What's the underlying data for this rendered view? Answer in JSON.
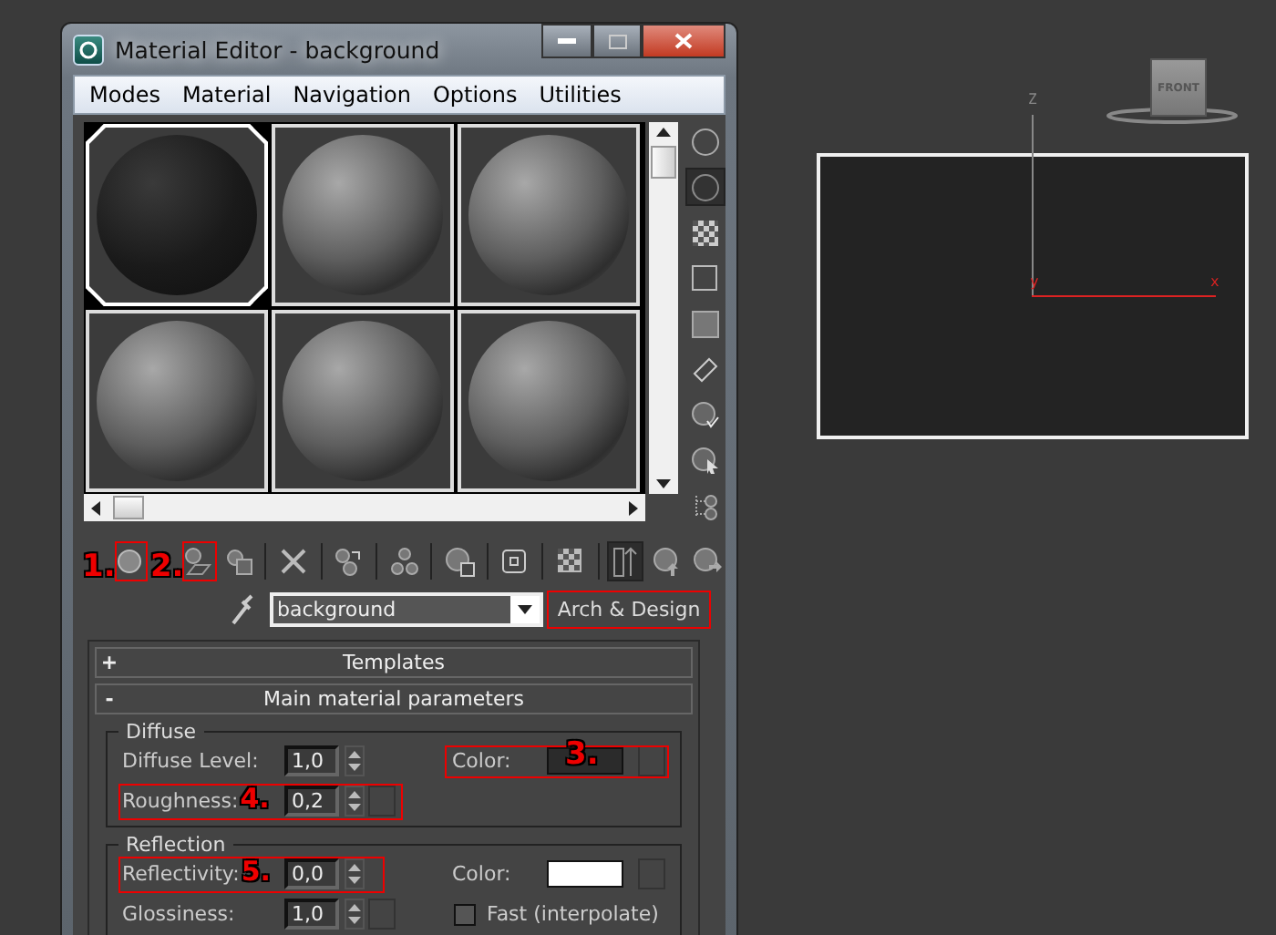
{
  "window": {
    "title": "Material Editor - background"
  },
  "menu": [
    "Modes",
    "Material",
    "Navigation",
    "Options",
    "Utilities"
  ],
  "slots": [
    {
      "selected": true
    },
    {
      "selected": false
    },
    {
      "selected": false
    },
    {
      "selected": false
    },
    {
      "selected": false
    },
    {
      "selected": false
    }
  ],
  "toolbar_annotations": [
    "1.",
    "2."
  ],
  "material": {
    "name": "background",
    "type": "Arch & Design",
    "type_highlighted": true
  },
  "rollouts": [
    {
      "sign": "+",
      "title": "Templates"
    },
    {
      "sign": "-",
      "title": "Main material parameters"
    }
  ],
  "diffuse": {
    "title": "Diffuse",
    "fields": [
      {
        "label": "Diffuse Level:",
        "value": "1,0",
        "map": false
      },
      {
        "label": "Roughness:",
        "value": "0,2",
        "map": true,
        "annotation": "4."
      }
    ],
    "color_label": "Color:",
    "color": "#2b2b2b",
    "color_annotation": "3."
  },
  "reflection": {
    "title": "Reflection",
    "fields": [
      {
        "label": "Reflectivity:",
        "value": "0,0",
        "map": false,
        "annotation": "5."
      },
      {
        "label": "Glossiness:",
        "value": "1,0",
        "map": true
      }
    ],
    "color_label": "Color:",
    "color": "#ffffff",
    "checkbox": {
      "label": "Fast (interpolate)",
      "checked": false
    }
  },
  "viewport": {
    "viewcube_label": "FRONT",
    "axes": [
      "Z",
      "y",
      "x"
    ]
  }
}
